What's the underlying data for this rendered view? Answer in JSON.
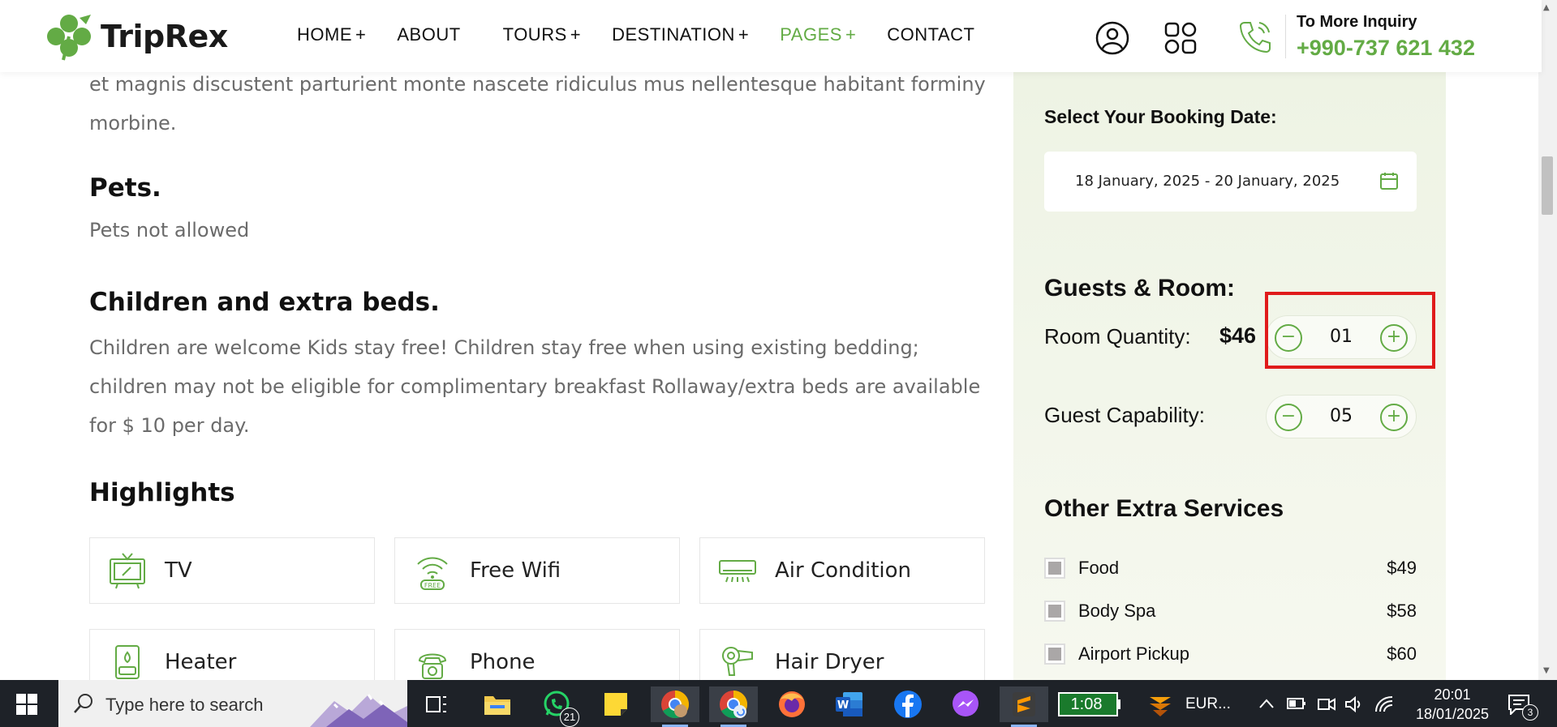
{
  "header": {
    "logo_text": "TripRex",
    "nav": [
      {
        "label": "HOME",
        "plus": "+"
      },
      {
        "label": "ABOUT",
        "plus": ""
      },
      {
        "label": "TOURS",
        "plus": "+"
      },
      {
        "label": "DESTINATION",
        "plus": "+"
      },
      {
        "label": "PAGES",
        "plus": "+"
      },
      {
        "label": "CONTACT",
        "plus": ""
      }
    ],
    "inquiry_label": "To More Inquiry",
    "inquiry_number": "+990-737 621 432"
  },
  "content": {
    "intro_paragraph": "et magnis discustent parturient monte nascete ridiculus mus nellentesque habitant forminy morbine.",
    "pets_title": "Pets.",
    "pets_text": "Pets not allowed",
    "children_title": "Children and extra beds.",
    "children_text": "Children are welcome Kids stay free! Children stay free when using existing bedding; children may not be eligible for complimentary breakfast Rollaway/extra beds are available for $ 10 per day.",
    "highlights_title": "Highlights",
    "highlights": [
      {
        "label": "TV",
        "icon": "tv-icon"
      },
      {
        "label": "Free Wifi",
        "icon": "wifi-icon"
      },
      {
        "label": "Air Condition",
        "icon": "air-conditioner-icon"
      },
      {
        "label": "Heater",
        "icon": "heater-icon"
      },
      {
        "label": "Phone",
        "icon": "phone-icon"
      },
      {
        "label": "Hair Dryer",
        "icon": "hair-dryer-icon"
      }
    ],
    "wifi_icon_label": "FREE"
  },
  "sidebar": {
    "booking_label": "Select Your Booking Date:",
    "booking_date": "18 January, 2025 - 20 January, 2025",
    "guests_title": "Guests & Room:",
    "room_quantity_label": "Room Quantity:",
    "room_price": "$46",
    "room_quantity_value": "01",
    "guest_capability_label": "Guest Capability:",
    "guest_capability_value": "05",
    "extra_title": "Other Extra Services",
    "services": [
      {
        "name": "Food",
        "price": "$49"
      },
      {
        "name": "Body Spa",
        "price": "$58"
      },
      {
        "name": "Airport Pickup",
        "price": "$60"
      }
    ],
    "minus": "−",
    "plus": "+"
  },
  "taskbar": {
    "search_placeholder": "Type here to search",
    "whatsapp_badge": "21",
    "battery_time": "1:08",
    "eur_label": "EUR...",
    "time": "20:01",
    "date": "18/01/2025",
    "notification_count": "3"
  },
  "colors": {
    "brand_green": "#63ab45",
    "highlight_red": "#e01b1b",
    "taskbar_bg": "#1e2228"
  }
}
